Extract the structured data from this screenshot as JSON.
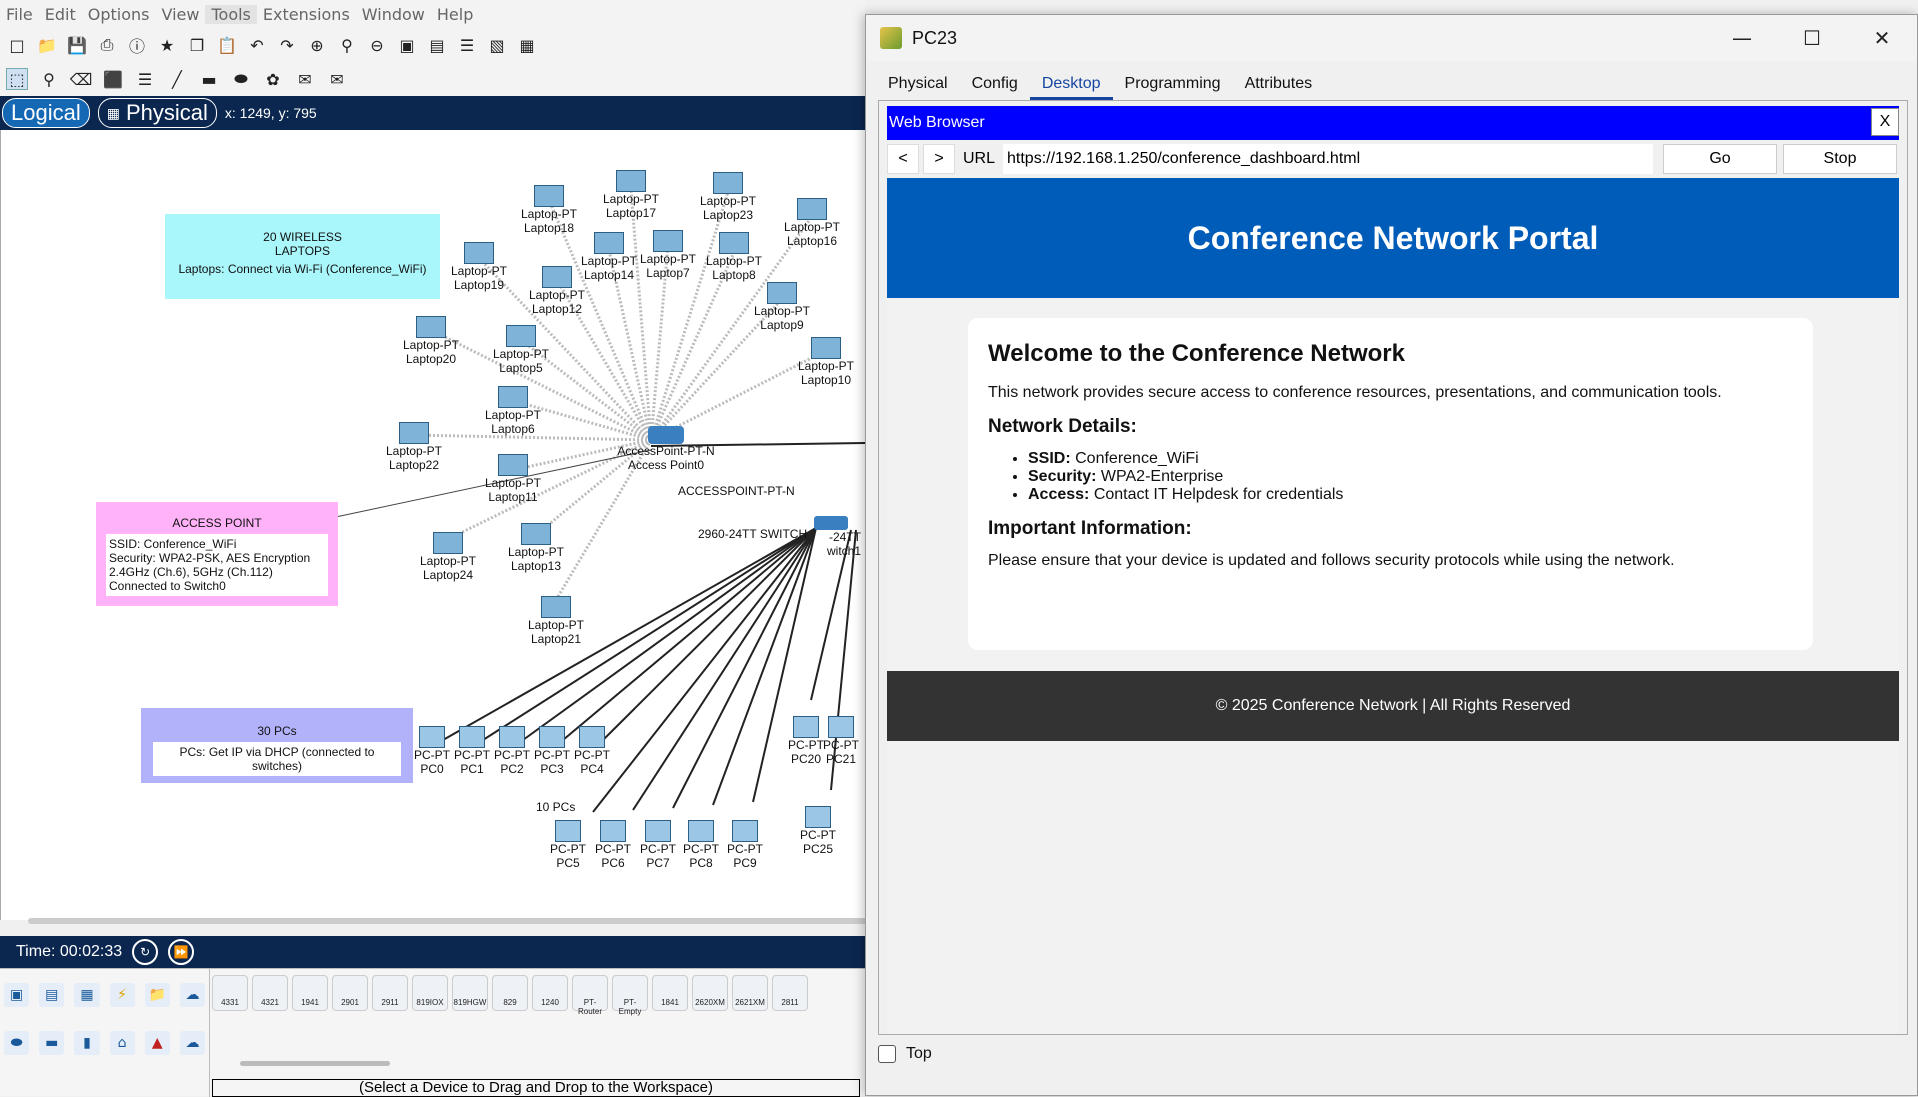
{
  "menu": [
    "File",
    "Edit",
    "Options",
    "View",
    "Tools",
    "Extensions",
    "Window",
    "Help"
  ],
  "mode": {
    "logical": "Logical",
    "physical": "Physical",
    "coords": "x: 1249, y: 795"
  },
  "notes": {
    "laptops_title": "20 WIRELESS LAPTOPS",
    "laptops_body": "Laptops: Connect via Wi-Fi (Conference_WiFi)",
    "ap_title": "ACCESS POINT",
    "ap_lines": [
      "SSID: Conference_WiFi",
      "Security: WPA2-PSK, AES Encryption",
      "2.4GHz (Ch.6), 5GHz (Ch.112)",
      "Connected to Switch0"
    ],
    "pcs_title": "30 PCs",
    "pcs_body": "PCs: Get IP via DHCP (connected to switches)",
    "ten_pcs": "10 PCs",
    "ap_label": "ACCESSPOINT-PT-N",
    "switch_label": "2960-24TT SWITCH"
  },
  "devices": {
    "ap": {
      "type": "AccessPoint-PT-N",
      "name": "Access Point0"
    },
    "switch": {
      "type": "-24TT",
      "name": "witch1"
    },
    "laptop_type": "Laptop-PT",
    "pc_type": "PC-PT",
    "laptops": [
      "Laptop18",
      "Laptop17",
      "Laptop23",
      "Laptop16",
      "Laptop19",
      "Laptop14",
      "Laptop7",
      "Laptop8",
      "Laptop12",
      "Laptop9",
      "Laptop20",
      "Laptop5",
      "Laptop10",
      "Laptop6",
      "Laptop22",
      "Laptop11",
      "Laptop24",
      "Laptop13",
      "Laptop21"
    ],
    "pcs": [
      "PC0",
      "PC1",
      "PC2",
      "PC3",
      "PC4",
      "PC5",
      "PC6",
      "PC7",
      "PC8",
      "PC9",
      "PC20",
      "PC21",
      "PC25"
    ]
  },
  "time": {
    "label": "Time: 00:02:33"
  },
  "palette": {
    "models": [
      "4331",
      "4321",
      "1941",
      "2901",
      "2911",
      "819IOX",
      "819HGW",
      "829",
      "1240",
      "PT-Router",
      "PT-Empty",
      "1841",
      "2620XM",
      "2621XM",
      "2811"
    ],
    "status": "(Select a Device to Drag and Drop to the Workspace)"
  },
  "window": {
    "title": "PC23",
    "tabs": [
      "Physical",
      "Config",
      "Desktop",
      "Programming",
      "Attributes"
    ],
    "selected_tab": "Desktop",
    "browser_title": "Web Browser",
    "close": "X",
    "back": "<",
    "forward": ">",
    "url_label": "URL",
    "url": "https://192.168.1.250/conference_dashboard.html",
    "go": "Go",
    "stop": "Stop",
    "top_label": "Top"
  },
  "page": {
    "header": "Conference Network Portal",
    "welcome": "Welcome to the Conference Network",
    "intro": "This network provides secure access to conference resources, presentations, and communication tools.",
    "details_title": "Network Details:",
    "details": [
      {
        "key": "SSID:",
        "value": " Conference_WiFi"
      },
      {
        "key": "Security:",
        "value": " WPA2-Enterprise"
      },
      {
        "key": "Access:",
        "value": " Contact IT Helpdesk for credentials"
      }
    ],
    "info_title": "Important Information:",
    "info": "Please ensure that your device is updated and follows security protocols while using the network.",
    "footer": "© 2025 Conference Network | All Rights Reserved"
  },
  "colors": {
    "mode_bar": "#0b2750",
    "browser_head": "#0000ff",
    "portal_head": "#005cb9",
    "portal_foot": "#333333",
    "note_cyan": "#aaf7fb",
    "note_pink": "#ffb2f7",
    "note_purple": "#b2b2fa"
  }
}
